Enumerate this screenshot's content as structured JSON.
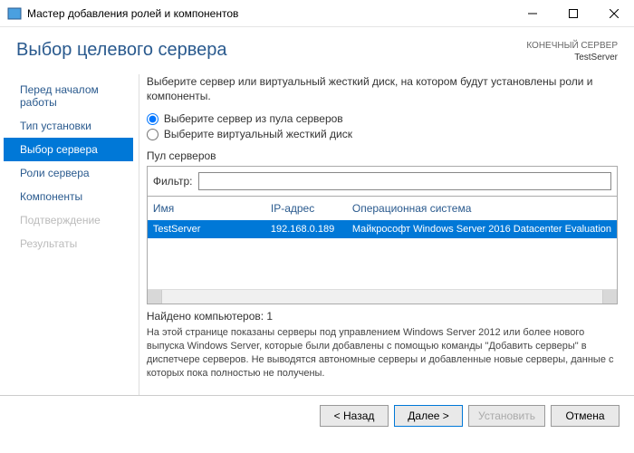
{
  "window": {
    "title": "Мастер добавления ролей и компонентов"
  },
  "header": {
    "title": "Выбор целевого сервера",
    "dest_label": "КОНЕЧНЫЙ СЕРВЕР",
    "dest_server": "TestServer"
  },
  "nav": {
    "items": [
      {
        "label": "Перед началом работы"
      },
      {
        "label": "Тип установки"
      },
      {
        "label": "Выбор сервера"
      },
      {
        "label": "Роли сервера"
      },
      {
        "label": "Компоненты"
      },
      {
        "label": "Подтверждение"
      },
      {
        "label": "Результаты"
      }
    ]
  },
  "content": {
    "intro": "Выберите сервер или виртуальный жесткий диск, на котором будут установлены роли и компоненты.",
    "radio_pool": "Выберите сервер из пула серверов",
    "radio_vhd": "Выберите виртуальный жесткий диск",
    "pool_label": "Пул серверов",
    "filter_label": "Фильтр:",
    "columns": {
      "name": "Имя",
      "ip": "IP-адрес",
      "os": "Операционная система"
    },
    "row": {
      "name": "TestServer",
      "ip": "192.168.0.189",
      "os": "Майкрософт Windows Server 2016 Datacenter Evaluation"
    },
    "count": "Найдено компьютеров: 1",
    "note": "На этой странице показаны серверы под управлением Windows Server 2012 или более нового выпуска Windows Server, которые были добавлены с помощью команды \"Добавить серверы\" в диспетчере серверов. Не выводятся автономные серверы и добавленные новые серверы, данные с которых пока полностью не получены."
  },
  "footer": {
    "back": "< Назад",
    "next": "Далее >",
    "install": "Установить",
    "cancel": "Отмена"
  }
}
